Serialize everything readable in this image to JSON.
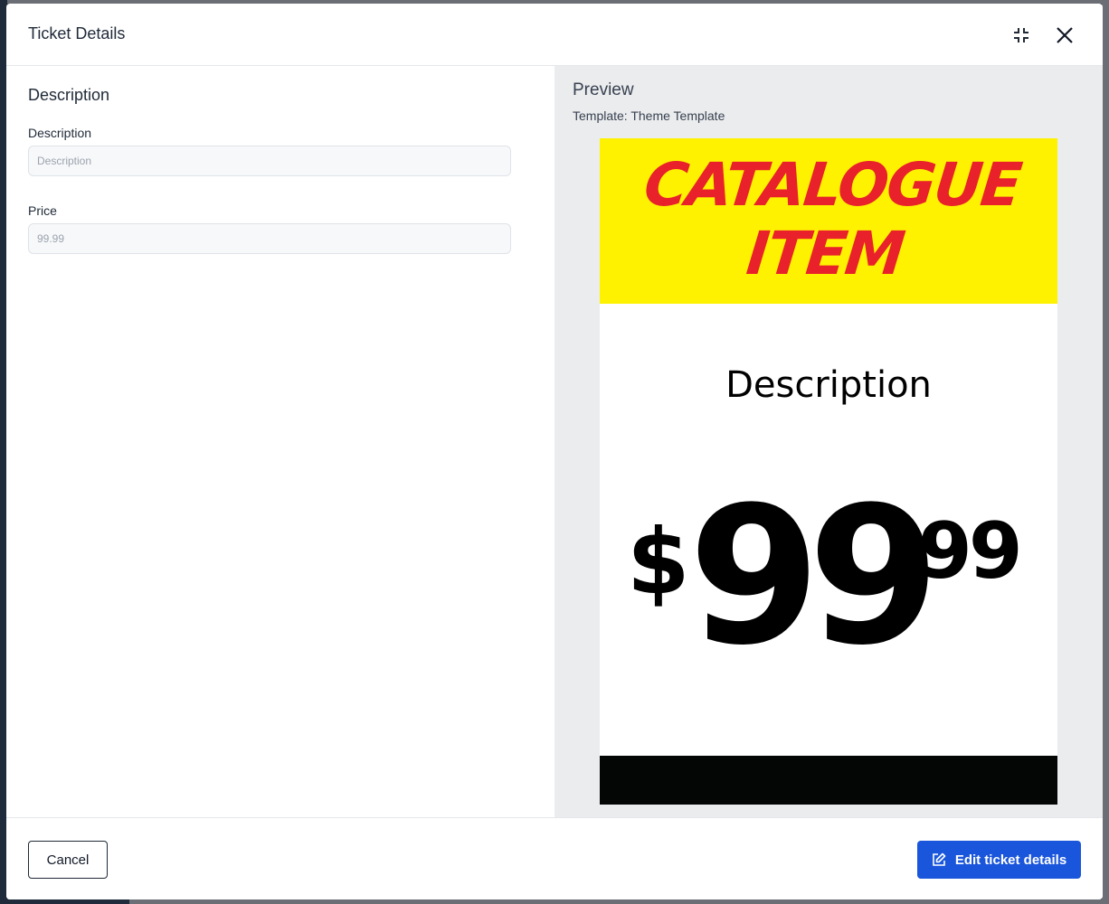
{
  "modal": {
    "title": "Ticket Details"
  },
  "form": {
    "section_title": "Description",
    "description": {
      "label": "Description",
      "value": "",
      "placeholder": "Description"
    },
    "price": {
      "label": "Price",
      "value": "",
      "placeholder": "99.99"
    }
  },
  "preview": {
    "title": "Preview",
    "template_label": "Template: Theme Template",
    "ticket": {
      "banner_line1": "CATALOGUE",
      "banner_line2": "ITEM",
      "description": "Description",
      "price_symbol": "$",
      "price_whole": "99",
      "price_cents": "99",
      "banner_color": "#fff200",
      "banner_text_color": "#e8212b",
      "footer_color": "#040605"
    }
  },
  "footer": {
    "cancel_label": "Cancel",
    "edit_label": "Edit ticket details"
  },
  "icons": {
    "compress": "compress-icon",
    "close": "close-icon",
    "edit": "edit-icon"
  },
  "colors": {
    "primary": "#1a56db"
  }
}
